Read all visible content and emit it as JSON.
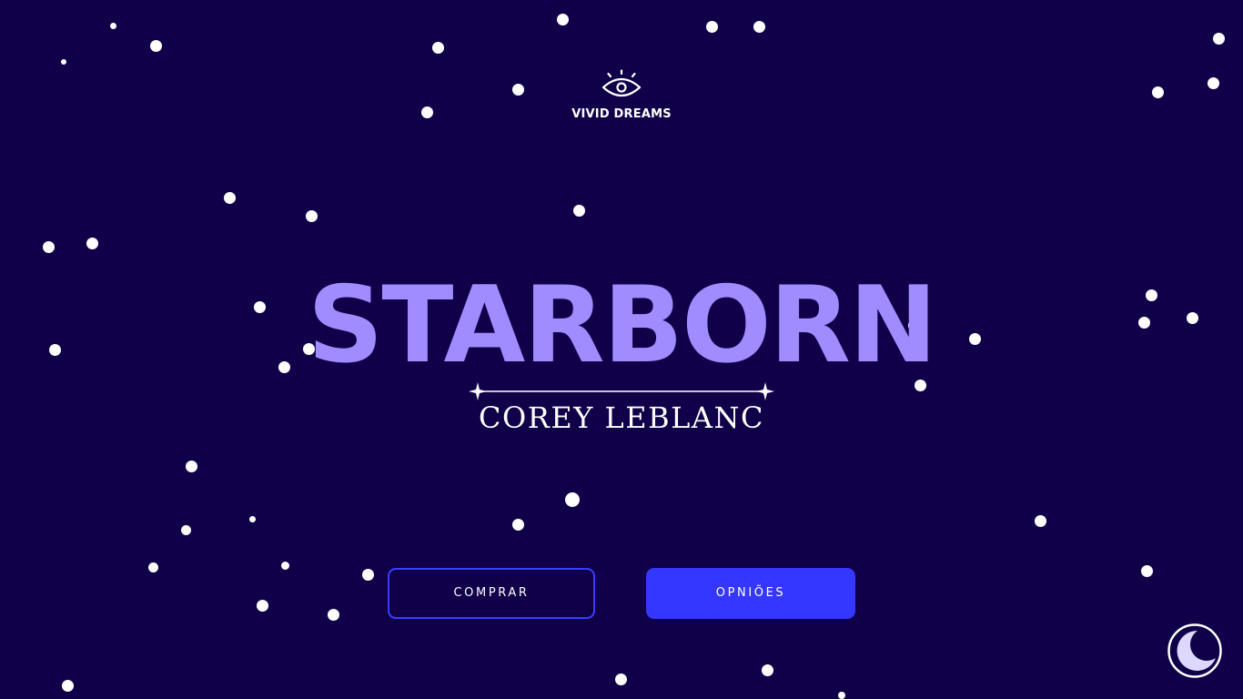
{
  "colors": {
    "background": "#10004a",
    "title": "#a08cff",
    "primary_button": "#3437ff",
    "star": "#ffffff"
  },
  "header": {
    "logo_icon": "eye-icon",
    "brand_name": "VIVID DREAMS"
  },
  "hero": {
    "title": "STARBORN",
    "divider_icon": "sparkle-divider-icon",
    "author": "COREY LEBLANC"
  },
  "actions": {
    "buy_label": "COMPRAR",
    "reviews_label": "OPNIÕES"
  },
  "theme_toggle": {
    "icon": "moon-icon"
  }
}
